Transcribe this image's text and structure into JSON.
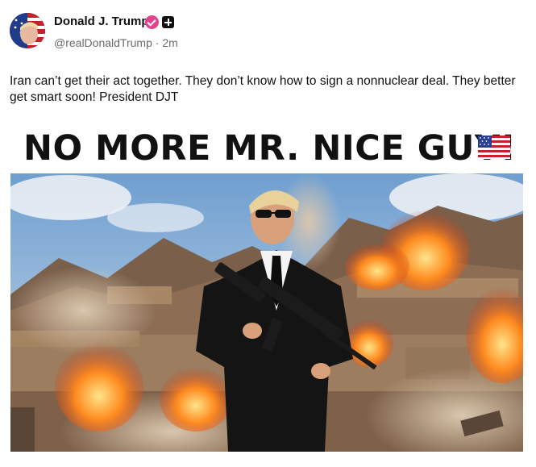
{
  "post": {
    "author_name": "Donald J. Trump",
    "handle": "@realDonaldTrump",
    "separator": "·",
    "time_ago": "2m",
    "text": "Iran can’t get their act together. They don’t know how to sign a nonnuclear deal. They better get smart soon! President DJT",
    "badge_color": "#e3438c"
  },
  "media": {
    "headline": "NO MORE MR. NICE GUY!",
    "flag_icon": "us-flag-icon"
  }
}
